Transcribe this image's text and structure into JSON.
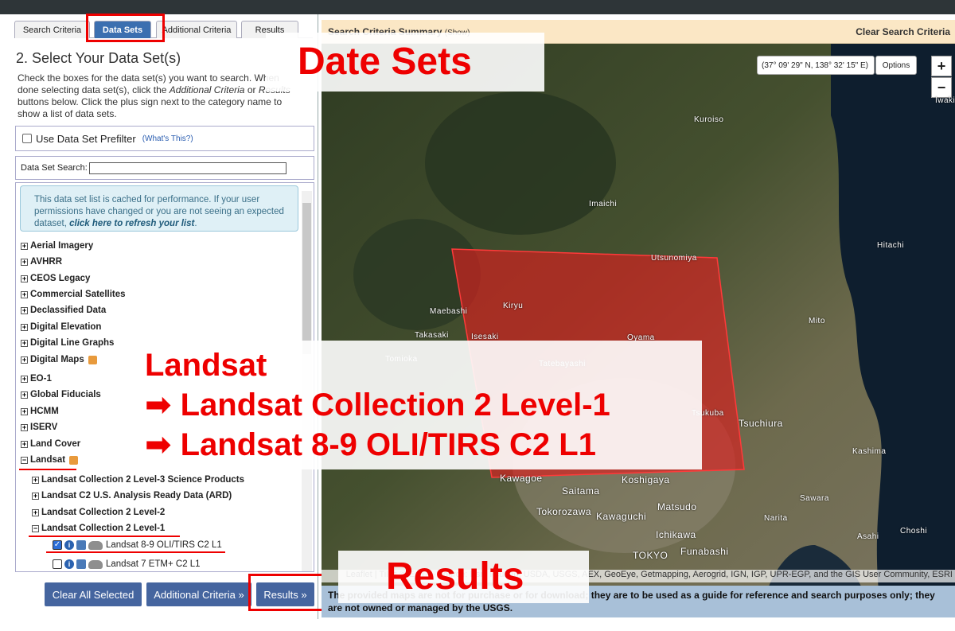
{
  "tabs": {
    "search_criteria": "Search Criteria",
    "data_sets": "Data Sets",
    "additional_criteria": "Additional Criteria",
    "results": "Results"
  },
  "section_title": "2. Select Your Data Set(s)",
  "instructions": {
    "part1": "Check the boxes for the data set(s) you want to search. When done selecting data set(s), click the ",
    "italic1": "Additional Criteria",
    "part2": " or ",
    "italic2": "Results",
    "part3": " buttons below. Click the plus sign next to the category name to show a list of data sets."
  },
  "prefilter": {
    "label": "Use Data Set Prefilter",
    "help": "(What's This?)"
  },
  "dataset_search": {
    "label": "Data Set Search:",
    "value": ""
  },
  "cache_notice": {
    "text": "This data set list is cached for performance. If your user permissions have changed or you are not seeing an expected dataset, ",
    "link": "click here to refresh your list",
    "end": "."
  },
  "categories": [
    {
      "label": "Aerial Imagery",
      "expanded": false
    },
    {
      "label": "AVHRR",
      "expanded": false
    },
    {
      "label": "CEOS Legacy",
      "expanded": false
    },
    {
      "label": "Commercial Satellites",
      "expanded": false
    },
    {
      "label": "Declassified Data",
      "expanded": false
    },
    {
      "label": "Digital Elevation",
      "expanded": false
    },
    {
      "label": "Digital Line Graphs",
      "expanded": false
    },
    {
      "label": "Digital Maps",
      "expanded": false
    },
    {
      "label": "EO-1",
      "expanded": false
    },
    {
      "label": "Global Fiducials",
      "expanded": false
    },
    {
      "label": "HCMM",
      "expanded": false
    },
    {
      "label": "ISERV",
      "expanded": false
    },
    {
      "label": "Land Cover",
      "expanded": false
    },
    {
      "label": "Landsat",
      "expanded": true
    }
  ],
  "landsat_children": [
    {
      "label": "Landsat Collection 2 Level-3 Science Products",
      "expanded": false
    },
    {
      "label": "Landsat C2 U.S. Analysis Ready Data (ARD)",
      "expanded": false
    },
    {
      "label": "Landsat Collection 2 Level-2",
      "expanded": false
    },
    {
      "label": "Landsat Collection 2 Level-1",
      "expanded": true
    }
  ],
  "datasets": [
    {
      "label": "Landsat 8-9 OLI/TIRS C2 L1",
      "checked": true
    },
    {
      "label": "Landsat 7 ETM+ C2 L1",
      "checked": false
    }
  ],
  "buttons": {
    "clear": "Clear All Selected",
    "additional": "Additional Criteria »",
    "results": "Results »"
  },
  "map": {
    "summary": "Search Criteria Summary",
    "show": "(Show)",
    "clear": "Clear Search Criteria",
    "coords": "(37° 09' 29\" N, 138° 32' 15\" E)",
    "options": "Options",
    "zoom_in": "+",
    "zoom_out": "−",
    "cities": [
      "Iwaki",
      "Kuroiso",
      "Imaichi",
      "Hitachi",
      "Utsunomiya",
      "Kiryu",
      "Maebashi",
      "Takasaki",
      "Isesaki",
      "Oyama",
      "Mito",
      "Tomioka",
      "Tatebayashi",
      "Tsukuba",
      "Tsuchiura",
      "Kashima",
      "Kawagoe",
      "Saitama",
      "Koshigaya",
      "Tokorozawa",
      "Kawaguchi",
      "Matsudo",
      "Sawara",
      "Narita",
      "Ichikawa",
      "Choshi",
      "Asahi",
      "TOKYO",
      "Funabashi"
    ],
    "attribution": "Leaflet | Tiles © Esri — Source: Esri, i-cubed, USDA, USGS, AEX, GeoEye, Getmapping, Aerogrid, IGN, IGP, UPR-EGP, and the GIS User Community, ESRI",
    "disclaimer": "The provided maps are not for purchase or for download; they are to be used as a guide for reference and search purposes only; they are not owned or managed by the USGS."
  },
  "annotations": {
    "datasets": "Date Sets",
    "landsat": "Landsat",
    "arrow1": "➡ Landsat Collection 2 Level-1",
    "arrow2": "➡ Landsat 8-9 OLI/TIRS C2 L1",
    "results": "Results"
  },
  "colors": {
    "accent": "#3b6fb0",
    "button": "#45659f",
    "highlight": "#ee0000",
    "footprint": "rgba(220,30,30,0.65)"
  }
}
